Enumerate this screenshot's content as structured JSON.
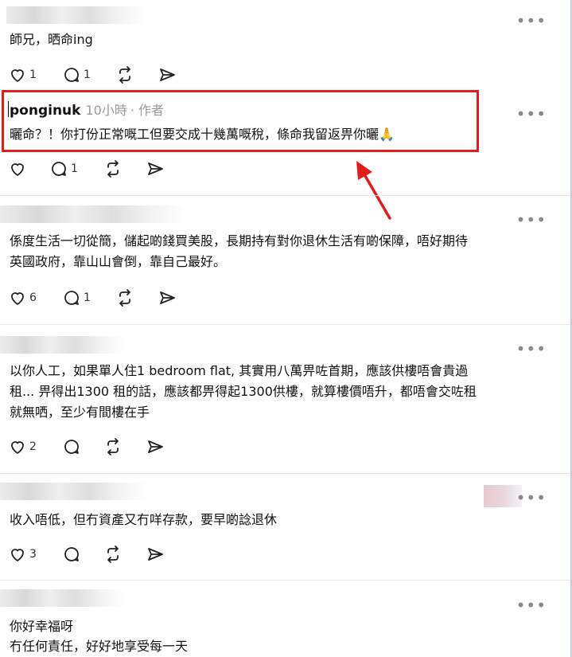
{
  "posts": [
    {
      "text": "師兄，晒命ing",
      "likes": "1",
      "replies": "1"
    },
    {
      "username": "ponginuk",
      "time": "10小時",
      "author_tag": "· 作者",
      "text": "曬命？！你打份正常嘅工但要交成十幾萬嘅稅，條命我留返畀你曬🙏",
      "likes": "",
      "replies": "1"
    },
    {
      "text_lines": [
        "係度生活一切從簡，儲起啲錢買美股，長期持有對你退休生活有啲保障，唔好期待",
        "英國政府，靠山山會倒，靠自己最好。"
      ],
      "likes": "6",
      "replies": "1"
    },
    {
      "text_lines": [
        "以你人工，如果單人住1 bedroom flat, 其實用八萬畀咗首期，應該供樓唔會貴過",
        "租... 畀得出1300 租的話，應該都畀得起1300供樓，就算樓價唔升，都唔會交咗租",
        "就無哂，至少有間樓在手"
      ],
      "likes": "2",
      "replies": ""
    },
    {
      "text": "收入唔低，但冇資產又冇咩存款，要早啲諗退休",
      "likes": "3",
      "replies": ""
    },
    {
      "text_lines": [
        "你好幸福呀",
        "冇任何責任，好好地享受每一天"
      ]
    }
  ],
  "more_glyph": "•••",
  "icons": {
    "like": "heart-icon",
    "reply": "comment-icon",
    "repost": "repost-icon",
    "share": "share-icon"
  },
  "colors": {
    "highlight": "#e31b1b",
    "arrow": "#e31b1b",
    "muted": "#999999"
  }
}
